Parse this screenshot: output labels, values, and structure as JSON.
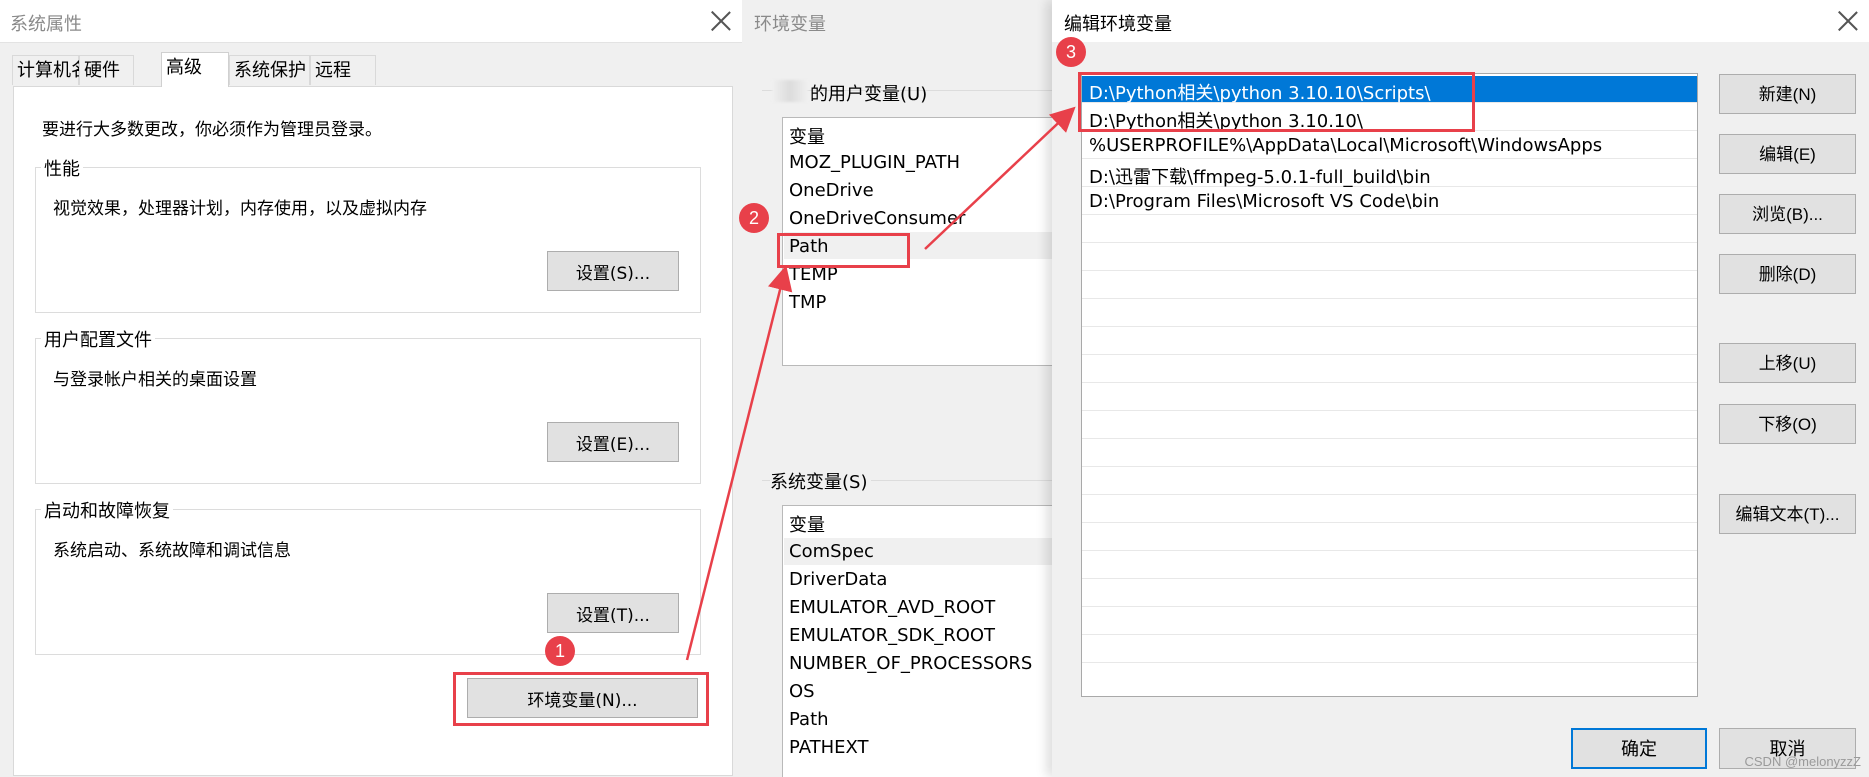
{
  "sysprops": {
    "title": "系统属性",
    "tabs": [
      "计算机名",
      "硬件",
      "高级",
      "系统保护",
      "远程"
    ],
    "admin_note": "要进行大多数更改，你必须作为管理员登录。",
    "performance": {
      "label": "性能",
      "desc": "视觉效果，处理器计划，内存使用，以及虚拟内存",
      "button": "设置(S)..."
    },
    "user_profiles": {
      "label": "用户配置文件",
      "desc": "与登录帐户相关的桌面设置",
      "button": "设置(E)..."
    },
    "startup": {
      "label": "启动和故障恢复",
      "desc": "系统启动、系统故障和调试信息",
      "button": "设置(T)..."
    },
    "env_button": "环境变量(N)..."
  },
  "envvars": {
    "title": "环境变量",
    "user_section": "的用户变量(U)",
    "user_header": "变量",
    "user_vars": [
      "MOZ_PLUGIN_PATH",
      "OneDrive",
      "OneDriveConsumer",
      "Path",
      "TEMP",
      "TMP"
    ],
    "system_section": "系统变量(S)",
    "system_header": "变量",
    "system_vars": [
      "ComSpec",
      "DriverData",
      "EMULATOR_AVD_ROOT",
      "EMULATOR_SDK_ROOT",
      "NUMBER_OF_PROCESSORS",
      "OS",
      "Path",
      "PATHEXT"
    ]
  },
  "editenv": {
    "title": "编辑环境变量",
    "paths": [
      "D:\\Python相关\\python 3.10.10\\Scripts\\",
      "D:\\Python相关\\python 3.10.10\\",
      "%USERPROFILE%\\AppData\\Local\\Microsoft\\WindowsApps",
      "D:\\迅雷下载\\ffmpeg-5.0.1-full_build\\bin",
      "D:\\Program Files\\Microsoft VS Code\\bin"
    ],
    "buttons": {
      "new": "新建(N)",
      "edit": "编辑(E)",
      "browse": "浏览(B)...",
      "delete": "删除(D)",
      "move_up": "上移(U)",
      "move_down": "下移(O)",
      "edit_text": "编辑文本(T)..."
    },
    "ok": "确定",
    "cancel": "取消"
  },
  "annotations": {
    "step1": "1",
    "step2": "2",
    "step3": "3",
    "color": "#e8404a"
  },
  "watermark": "CSDN @melonyzzZ",
  "colors": {
    "selection": "#0078d7",
    "dialog_bg": "#f0f0f0"
  }
}
